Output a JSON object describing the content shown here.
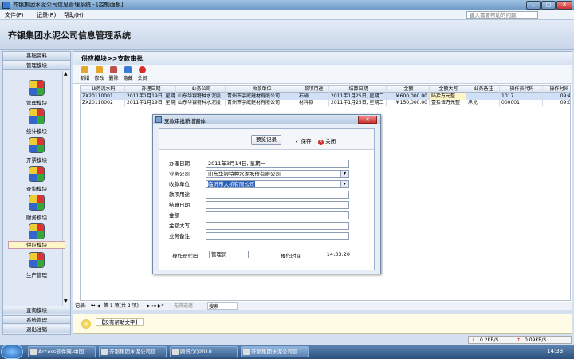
{
  "window": {
    "title": "齐银集团水泥公司信息管理系统 - [控制面板]",
    "minimize": "–",
    "maximize": "□",
    "close": "✕"
  },
  "menu": {
    "items": [
      "文件(F)",
      "记录(R)",
      "帮助(H)"
    ],
    "help_placeholder": "键入需要帮助的问题"
  },
  "banner": {
    "title": "齐银集团水泥公司信息管理系统"
  },
  "nav": {
    "top_headers": [
      "基础资料",
      "管理模块"
    ],
    "items": [
      {
        "label": "管理模块",
        "icon": "module-icon"
      },
      {
        "label": "统计模块",
        "icon": "module-icon"
      },
      {
        "label": "开票模块",
        "icon": "module-icon"
      },
      {
        "label": "查询模块",
        "icon": "module-icon"
      },
      {
        "label": "财务模块",
        "icon": "module-icon"
      },
      {
        "label": "供应模块",
        "icon": "module-icon",
        "selected": true
      },
      {
        "label": "生产管理",
        "icon": "module-icon"
      }
    ],
    "bottom_headers": [
      "查询模块",
      "系统管理",
      "退出注销"
    ]
  },
  "main": {
    "header": "供应模块>>支款审批",
    "toolbar": [
      {
        "label": "新增",
        "color": "#e5a72c"
      },
      {
        "label": "修改",
        "color": "#e5a72c"
      },
      {
        "label": "删除",
        "color": "#c0504d"
      },
      {
        "label": "隐藏",
        "color": "#3a7bd5"
      },
      {
        "label": "关闭",
        "color": "#d62b2b"
      }
    ],
    "columns": [
      "业务流水码",
      "办理日期",
      "业务公司",
      "收款单位",
      "款项用途",
      "结算日期",
      "金额",
      "金额大写",
      "业务备注",
      "操作员代码",
      "操作时间"
    ],
    "rows": [
      [
        "ZX20110001",
        "2011年1月19日, 星期三",
        "山东华银特种水泥股",
        "青州市宇威建材有限公司",
        "石硝",
        "2011年1月25日, 星期二",
        "￥600,000.00",
        "陆拾万元整",
        "",
        "1017",
        "09:42"
      ],
      [
        "ZX20110002",
        "2011年1月19日, 星期三",
        "山东华银特种水泥股",
        "青州市宇威建材有限公司",
        "材料款",
        "2011年1月25日, 星期二",
        "￥150,000.00",
        "壹拾伍万元整",
        "承兑",
        "000001",
        "09:06"
      ]
    ],
    "status": {
      "record_label": "记录:",
      "record_text": "第 1 项(共 2 项)",
      "filter": "无筛选器",
      "search": "搜索"
    }
  },
  "help": {
    "text": "【没有帮助文字】"
  },
  "net": {
    "down": "0.2KB/S",
    "up": "0.09KB/S"
  },
  "dialog": {
    "title": "支款审批新增窗体",
    "close": "✕",
    "preview_btn": "预览记录",
    "save_btn": "保存",
    "close_btn": "关闭",
    "fields": [
      {
        "label": "办理日期",
        "value": "2011年3月14日, 星期一",
        "combo": false
      },
      {
        "label": "业务公司",
        "value": "山东华银特种水泥股份有限公司",
        "combo": true
      },
      {
        "label": "收款单位",
        "value": "临沂市大桥有限公司",
        "combo": true,
        "highlight": true
      },
      {
        "label": "款项用途",
        "value": "",
        "combo": false
      },
      {
        "label": "结算日期",
        "value": "",
        "combo": false
      },
      {
        "label": "金额",
        "value": "",
        "combo": false
      },
      {
        "label": "金额大写",
        "value": "",
        "combo": false
      },
      {
        "label": "业务备注",
        "value": "",
        "combo": false
      }
    ],
    "operator_label": "操作员代码",
    "operator_value": "管理员",
    "time_label": "操作时间",
    "time_value": "14:33:20"
  },
  "taskbar": {
    "tasks": [
      "Access软件网-中国...",
      "齐银集团水泥公司信...",
      "腾讯QQ2010",
      "齐银集团水泥公司信..."
    ],
    "clock": "14:33"
  }
}
